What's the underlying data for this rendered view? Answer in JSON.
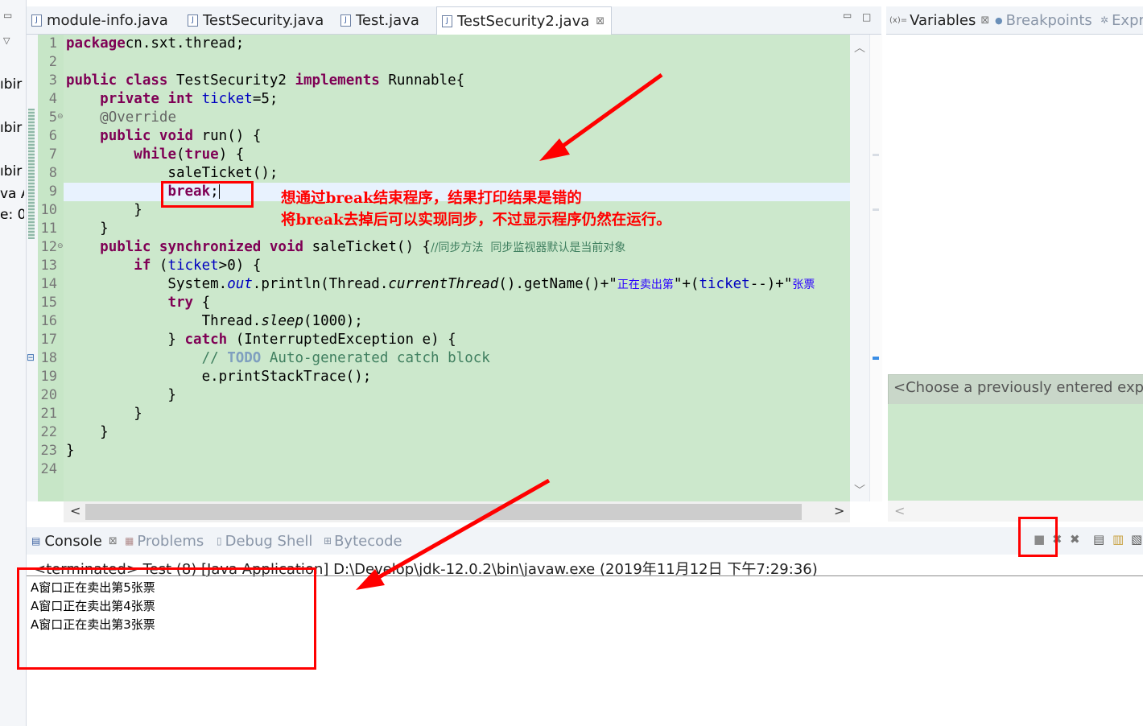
{
  "left_strip": {
    "fragments": [
      "ıbir",
      "ıbir",
      "ıbir",
      "va A",
      "e: 0"
    ]
  },
  "editor": {
    "tabs": [
      {
        "label": "module-info.java",
        "active": false
      },
      {
        "label": "TestSecurity.java",
        "active": false
      },
      {
        "label": "Test.java",
        "active": false
      },
      {
        "label": "TestSecurity2.java",
        "active": true
      }
    ],
    "close_glyph": "⊠",
    "line_numbers": [
      "1",
      "2",
      "3",
      "4",
      "5",
      "6",
      "7",
      "8",
      "9",
      "10",
      "11",
      "12",
      "13",
      "14",
      "15",
      "16",
      "17",
      "18",
      "19",
      "20",
      "21",
      "22",
      "23",
      "24"
    ],
    "code": [
      [
        [
          "kw",
          "package"
        ],
        [
          "",
          "cn.sxt.thread;"
        ]
      ],
      [],
      [
        [
          "kw",
          "public class"
        ],
        [
          "",
          " TestSecurity2 "
        ],
        [
          "kw",
          "implements"
        ],
        [
          "",
          " Runnable{"
        ]
      ],
      [
        [
          "",
          "    "
        ],
        [
          "kw",
          "private int"
        ],
        [
          "",
          ""
        ],
        [
          "fld",
          " ticket"
        ],
        [
          "",
          "=5;"
        ]
      ],
      [
        [
          "",
          "    "
        ],
        [
          "ann",
          "@Override"
        ]
      ],
      [
        [
          "",
          "    "
        ],
        [
          "kw",
          "public void"
        ],
        [
          "",
          " run() {"
        ]
      ],
      [
        [
          "",
          "        "
        ],
        [
          "kw",
          "while"
        ],
        [
          "",
          "("
        ],
        [
          "kw",
          "true"
        ],
        [
          "",
          ") {"
        ]
      ],
      [
        [
          "",
          "            saleTicket();"
        ]
      ],
      [
        [
          "",
          "            "
        ],
        [
          "kw",
          "break"
        ],
        [
          "",
          ";"
        ]
      ],
      [
        [
          "",
          "        }"
        ]
      ],
      [
        [
          "",
          "    }"
        ]
      ],
      [
        [
          "",
          "    "
        ],
        [
          "kw",
          "public synchronized void"
        ],
        [
          "",
          " saleTicket() {"
        ],
        [
          "cmtsm",
          "//同步方法  同步监视器默认是当前对象"
        ]
      ],
      [
        [
          "",
          "        "
        ],
        [
          "kw",
          "if"
        ],
        [
          "",
          " ("
        ],
        [
          "fld",
          "ticket"
        ],
        [
          "",
          ">0) {"
        ]
      ],
      [
        [
          "",
          "            System."
        ],
        [
          "fld it",
          "out"
        ],
        [
          "",
          ".println(Thread."
        ],
        [
          "it",
          "currentThread"
        ],
        [
          "",
          "().getName()+\""
        ],
        [
          "str",
          "正在卖出第"
        ],
        [
          "",
          "\"+("
        ],
        [
          "fld",
          "ticket"
        ],
        [
          "",
          "--)+\""
        ],
        [
          "str",
          "张票"
        ]
      ],
      [
        [
          "",
          "            "
        ],
        [
          "kw",
          "try"
        ],
        [
          "",
          " {"
        ]
      ],
      [
        [
          "",
          "                Thread."
        ],
        [
          "it",
          "sleep"
        ],
        [
          "",
          "(1000);"
        ]
      ],
      [
        [
          "",
          "            } "
        ],
        [
          "kw",
          "catch"
        ],
        [
          "",
          " (InterruptedException e) {"
        ]
      ],
      [
        [
          "",
          "                "
        ],
        [
          "cmt",
          "// "
        ],
        [
          "todo",
          "TODO"
        ],
        [
          "cmt",
          " Auto-generated catch block"
        ]
      ],
      [
        [
          "",
          "                e.printStackTrace();"
        ]
      ],
      [
        [
          "",
          "            }"
        ]
      ],
      [
        [
          "",
          "        }"
        ]
      ],
      [
        [
          "",
          "    }"
        ]
      ],
      [
        [
          "",
          "}"
        ]
      ],
      []
    ]
  },
  "annotation": {
    "line1": "想通过break结束程序，结果打印结果是错的",
    "line2": "将break去掉后可以实现同步，不过显示程序仍然在运行。"
  },
  "right_panel": {
    "tabs": [
      "Variables",
      "Breakpoints",
      "Expr"
    ],
    "expression_placeholder": "<Choose a previously entered expres"
  },
  "console": {
    "tabs": [
      {
        "label": "Console",
        "active": true
      },
      {
        "label": "Problems",
        "active": false
      },
      {
        "label": "Debug Shell",
        "active": false
      },
      {
        "label": "Bytecode",
        "active": false
      }
    ],
    "terminated_line": "<terminated> Test (8) [Java Application] D:\\Develop\\jdk-12.0.2\\bin\\javaw.exe (2019年11月12日 下午7:29:36)",
    "output": [
      "A窗口正在卖出第5张票",
      "A窗口正在卖出第4张票",
      "A窗口正在卖出第3张票"
    ]
  },
  "colors": {
    "annotation_red": "#ff0000",
    "editor_bg": "#cce8cc",
    "keyword": "#7f0055",
    "field": "#0000c0",
    "comment": "#3f7f5f"
  }
}
